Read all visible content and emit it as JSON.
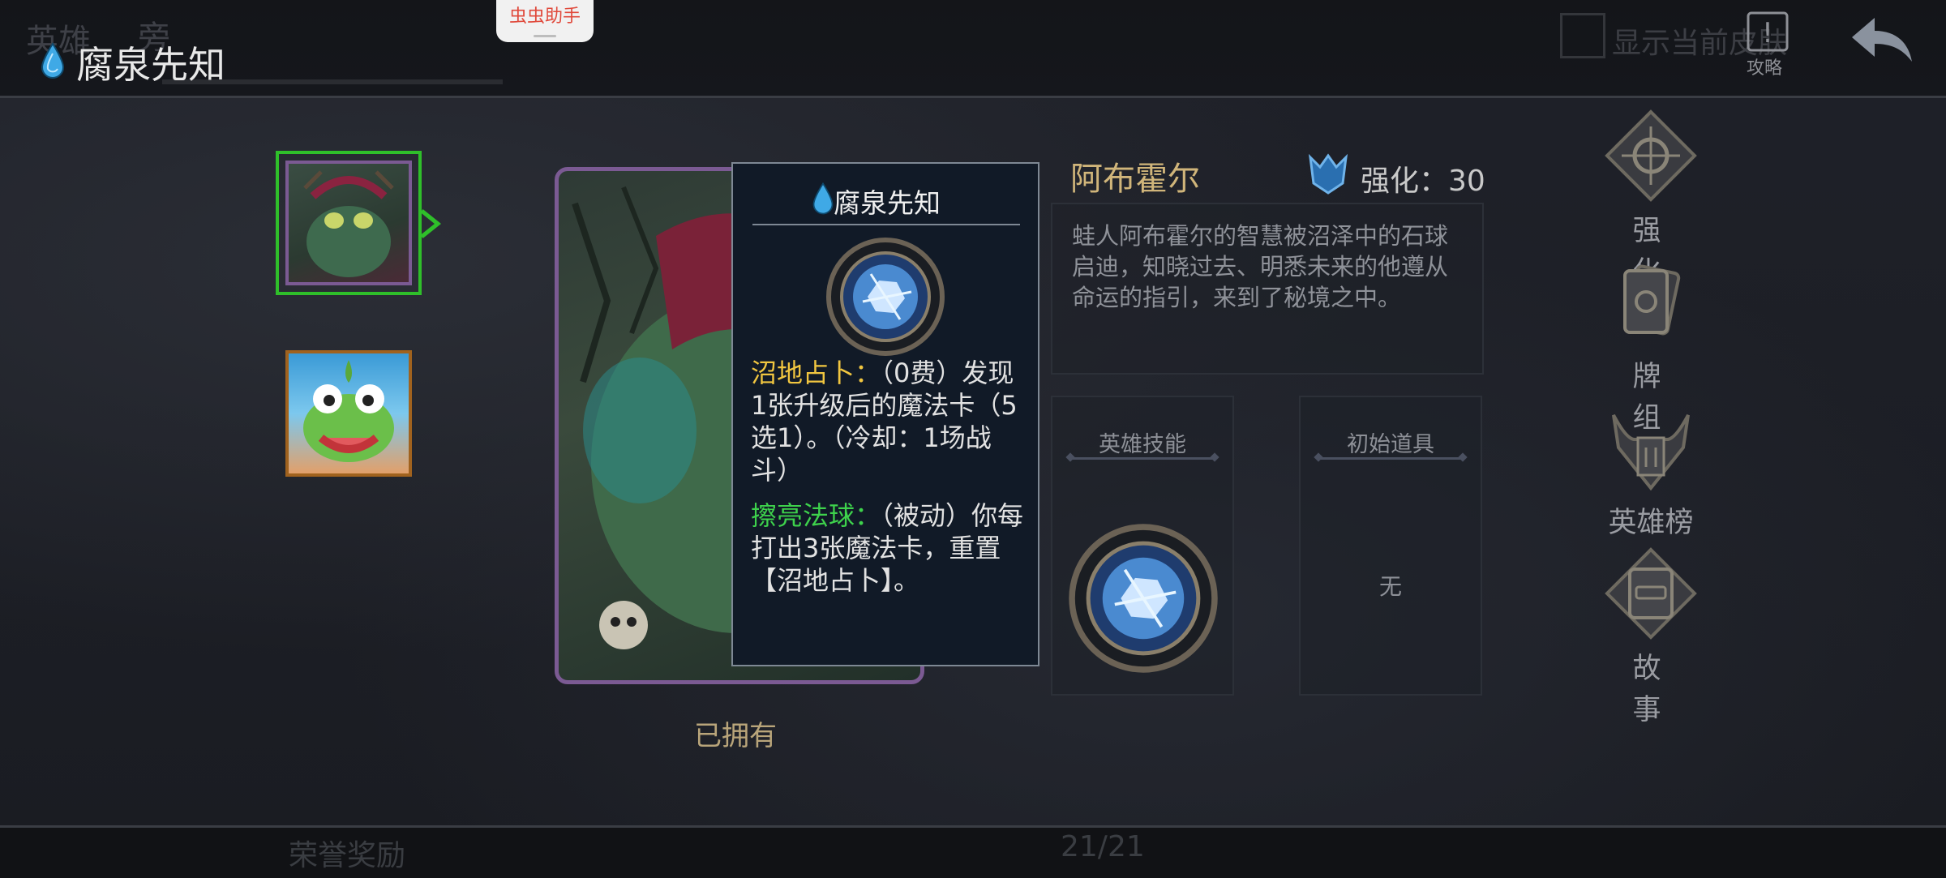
{
  "helper_tab": "虫虫助手",
  "header": {
    "ghost_tabs": [
      "英雄",
      "旁"
    ],
    "title": "腐泉先知",
    "show_skin_label": "显示当前皮肤",
    "guide_label": "攻略"
  },
  "hero_list": [
    {
      "name": "腐泉先知",
      "selected": true
    },
    {
      "name": "frog-hero-2",
      "selected": false
    }
  ],
  "portrait": {
    "status": "已拥有"
  },
  "tooltip": {
    "title": "腐泉先知",
    "skill1_name": "沼地占卜：",
    "skill1_body": "（0费）发现1张升级后的魔法卡（5选1）。（冷却：1场战斗）",
    "skill2_name": "擦亮法球：",
    "skill2_body": "（被动）你每打出3张魔法卡，重置【沼地占卜】。"
  },
  "hero_info": {
    "name": "阿布霍尔",
    "strength_label": "强化：30",
    "description": "蛙人阿布霍尔的智慧被沼泽中的石球启迪，知晓过去、明悉未来的他遵从命运的指引，来到了秘境之中。"
  },
  "panels": {
    "skill_label": "英雄技能",
    "item_label": "初始道具",
    "item_value": "无"
  },
  "side_menu": [
    "强　化",
    "牌　组",
    "英雄榜",
    "故　事"
  ],
  "footer": {
    "honor_label": "荣誉奖励",
    "page": "21/21"
  },
  "colors": {
    "gold": "#f1c640",
    "green": "#3ed24c",
    "select_green": "#2fbf2a",
    "frame_purple": "#7b5a93"
  }
}
